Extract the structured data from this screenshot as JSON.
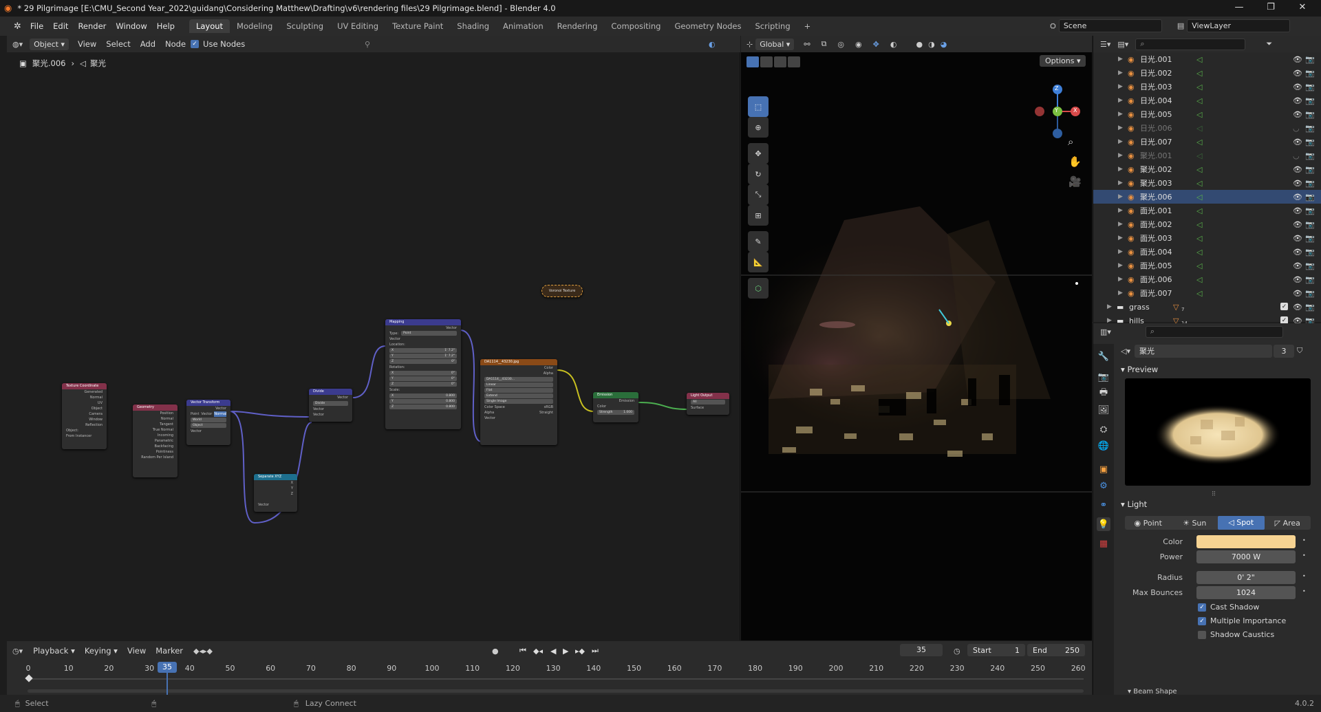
{
  "window": {
    "title": "* 29 Pilgrimage [E:\\CMU_Second Year_2022\\guidang\\Considering Matthew\\Drafting\\v6\\rendering files\\29 Pilgrimage.blend] - Blender 4.0",
    "min": "—",
    "max": "❐",
    "close": "✕"
  },
  "menu": [
    "File",
    "Edit",
    "Render",
    "Window",
    "Help"
  ],
  "workspaces": [
    {
      "label": "Layout",
      "active": true
    },
    {
      "label": "Modeling"
    },
    {
      "label": "Sculpting"
    },
    {
      "label": "UV Editing"
    },
    {
      "label": "Texture Paint"
    },
    {
      "label": "Shading"
    },
    {
      "label": "Animation"
    },
    {
      "label": "Rendering"
    },
    {
      "label": "Compositing"
    },
    {
      "label": "Geometry Nodes"
    },
    {
      "label": "Scripting"
    }
  ],
  "add_workspace": "+",
  "scene": "Scene",
  "view_layer": "ViewLayer",
  "node_header": {
    "object_mode": "Object",
    "view": "View",
    "select": "Select",
    "add": "Add",
    "node": "Node",
    "use_nodes": "Use Nodes"
  },
  "breadcrumb": {
    "object": "聚光.006",
    "data": "聚光"
  },
  "nodes": {
    "texcoord": {
      "title": "Texture Coordinate",
      "outs": [
        "Generated",
        "Normal",
        "UV",
        "Object",
        "Camera",
        "Window",
        "Reflection"
      ],
      "object_label": "Object:",
      "from_instancer": "From Instancer"
    },
    "geometry": {
      "title": "Geometry",
      "outs": [
        "Position",
        "Normal",
        "Tangent",
        "True Normal",
        "Incoming",
        "Parametric",
        "Backfacing",
        "Pointiness",
        "Random Per Island"
      ]
    },
    "vectransform": {
      "title": "Vector Transform",
      "out": "Vector",
      "types": [
        "Point",
        "Vector",
        "Normal"
      ],
      "from": "World",
      "to": "Object",
      "in": "Vector"
    },
    "separate": {
      "title": "Separate XYZ",
      "outs": [
        "X",
        "Y",
        "Z"
      ],
      "in": "Vector"
    },
    "divide": {
      "title": "Divide",
      "out": "Vector",
      "op": "Divide",
      "ins": [
        "Vector",
        "Vector"
      ]
    },
    "mapping": {
      "title": "Mapping",
      "out": "Vector",
      "type_label": "Type:",
      "type": "Point",
      "vector": "Vector",
      "loc_label": "Location:",
      "loc": [
        [
          "X",
          "1' 7.2\""
        ],
        [
          "Y",
          "1' 7.2\""
        ],
        [
          "Z",
          "0\""
        ]
      ],
      "rot_label": "Rotation:",
      "rot": [
        [
          "X",
          "0°"
        ],
        [
          "Y",
          "0°"
        ],
        [
          "Z",
          "0°"
        ]
      ],
      "scale_label": "Scale:",
      "scale": [
        [
          "X",
          "0.800"
        ],
        [
          "Y",
          "0.800"
        ],
        [
          "Z",
          "0.800"
        ]
      ]
    },
    "image": {
      "title": "DA1114__43230.jpg",
      "outs": [
        "Color",
        "Alpha"
      ],
      "file": "DA1114__43230...",
      "interp": "Linear",
      "proj": "Flat",
      "ext": "Extend",
      "src": "Single Image",
      "cs_label": "Color Space",
      "cs": "sRGB",
      "alpha_label": "Alpha",
      "alpha": "Straight",
      "in": "Vector"
    },
    "emission": {
      "title": "Emission",
      "out": "Emission",
      "color": "Color",
      "strength": "Strength",
      "strength_val": "1.000"
    },
    "lightout": {
      "title": "Light Output",
      "target": "All",
      "in": "Surface"
    },
    "reroute": {
      "title": "Voronoi Texture"
    }
  },
  "viewport": {
    "orientation": "Global",
    "options": "Options",
    "gizmo": {
      "z": "Z",
      "y": "Y",
      "x": "X"
    }
  },
  "outliner": {
    "search_placeholder": "",
    "items": [
      {
        "name": "日光.001",
        "dim": false
      },
      {
        "name": "日光.002",
        "dim": false
      },
      {
        "name": "日光.003",
        "dim": false
      },
      {
        "name": "日光.004",
        "dim": false
      },
      {
        "name": "日光.005",
        "dim": false
      },
      {
        "name": "日光.006",
        "dim": true
      },
      {
        "name": "日光.007",
        "dim": false
      },
      {
        "name": "聚光.001",
        "dim": true
      },
      {
        "name": "聚光.002",
        "dim": false
      },
      {
        "name": "聚光.003",
        "dim": false
      },
      {
        "name": "聚光.006",
        "dim": false,
        "selected": true
      },
      {
        "name": "面光.001",
        "dim": false
      },
      {
        "name": "面光.002",
        "dim": false
      },
      {
        "name": "面光.003",
        "dim": false
      },
      {
        "name": "面光.004",
        "dim": false
      },
      {
        "name": "面光.005",
        "dim": false
      },
      {
        "name": "面光.006",
        "dim": false
      },
      {
        "name": "面光.007",
        "dim": false
      },
      {
        "name": "grass",
        "dim": false,
        "collection": true,
        "badge": "7"
      },
      {
        "name": "hills",
        "dim": false,
        "collection": true,
        "badge": "14"
      }
    ]
  },
  "properties": {
    "data_name": "聚光",
    "users": "3",
    "preview": "Preview",
    "light": "Light",
    "types": [
      {
        "label": "Point"
      },
      {
        "label": "Sun"
      },
      {
        "label": "Spot",
        "active": true
      },
      {
        "label": "Area"
      }
    ],
    "color_label": "Color",
    "color": "#f6d392",
    "power_label": "Power",
    "power": "7000 W",
    "radius_label": "Radius",
    "radius": "0' 2\"",
    "bounces_label": "Max Bounces",
    "bounces": "1024",
    "cast_shadow": "Cast Shadow",
    "mis": "Multiple Importance",
    "caustics": "Shadow Caustics",
    "beam_shape": "Beam Shape"
  },
  "timeline": {
    "playback": "Playback",
    "keying": "Keying",
    "view": "View",
    "marker": "Marker",
    "current": "35",
    "start_label": "Start",
    "start": "1",
    "end_label": "End",
    "end": "250",
    "ticks": [
      "0",
      "10",
      "20",
      "30",
      "35",
      "40",
      "50",
      "60",
      "70",
      "80",
      "90",
      "100",
      "110",
      "120",
      "130",
      "140",
      "150",
      "160",
      "170",
      "180",
      "190",
      "200",
      "210",
      "220",
      "230",
      "240",
      "250",
      "260"
    ]
  },
  "status": {
    "select": "Select",
    "lazy": "Lazy Connect",
    "version": "4.0.2"
  },
  "colors": {
    "accent": "#4772b3",
    "selected_row": "#334a72",
    "light_green": "#59b44a"
  }
}
